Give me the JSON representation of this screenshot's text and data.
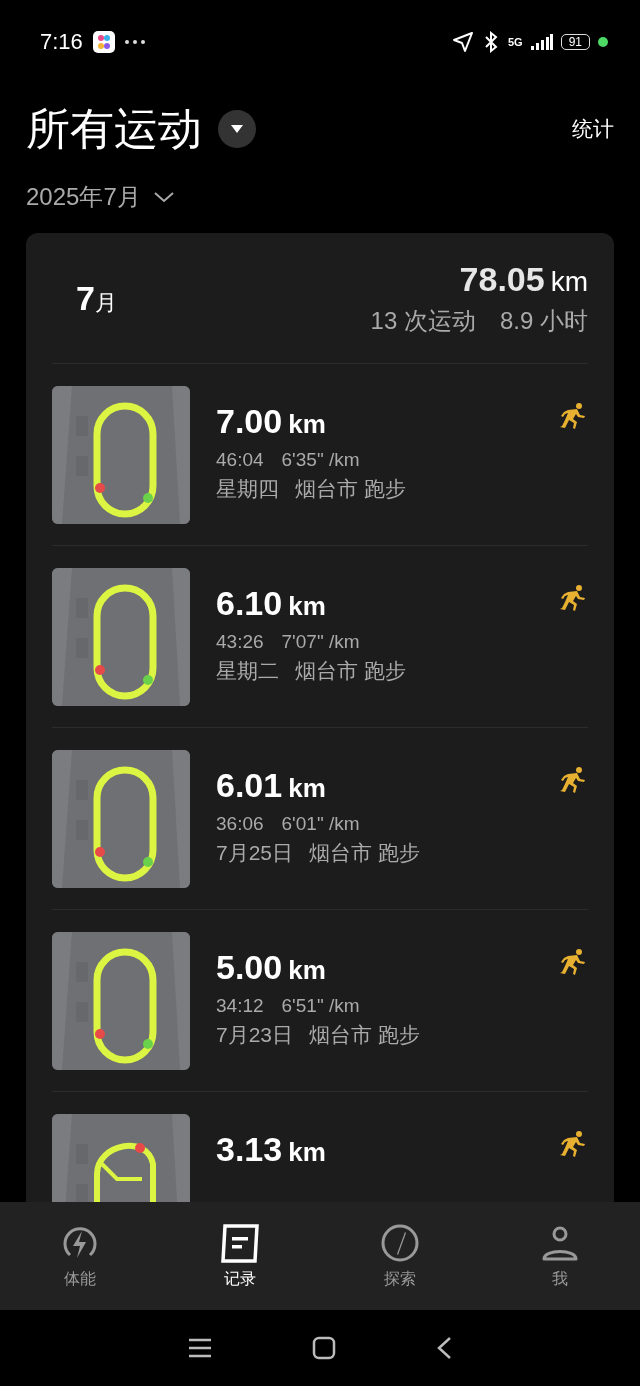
{
  "status_bar": {
    "time": "7:16",
    "network": "5G",
    "battery": "91"
  },
  "header": {
    "title": "所有运动",
    "action": "统计",
    "period": "2025年7月"
  },
  "summary": {
    "month": "7",
    "month_unit": "月",
    "distance": "78.05",
    "distance_unit": "km",
    "count": "13 次运动",
    "duration": "8.9 小时"
  },
  "activities": [
    {
      "distance": "7.00",
      "unit": "km",
      "time": "46:04",
      "pace": "6'35\" /km",
      "day": "星期四",
      "city": "烟台市",
      "sport": "跑步"
    },
    {
      "distance": "6.10",
      "unit": "km",
      "time": "43:26",
      "pace": "7'07\" /km",
      "day": "星期二",
      "city": "烟台市",
      "sport": "跑步"
    },
    {
      "distance": "6.01",
      "unit": "km",
      "time": "36:06",
      "pace": "6'01\" /km",
      "day": "7月25日",
      "city": "烟台市",
      "sport": "跑步"
    },
    {
      "distance": "5.00",
      "unit": "km",
      "time": "34:12",
      "pace": "6'51\" /km",
      "day": "7月23日",
      "city": "烟台市",
      "sport": "跑步"
    },
    {
      "distance": "3.13",
      "unit": "km"
    }
  ],
  "tabs": [
    {
      "label": "体能",
      "selected": false
    },
    {
      "label": "记录",
      "selected": true
    },
    {
      "label": "探索",
      "selected": false
    },
    {
      "label": "我",
      "selected": false
    }
  ]
}
